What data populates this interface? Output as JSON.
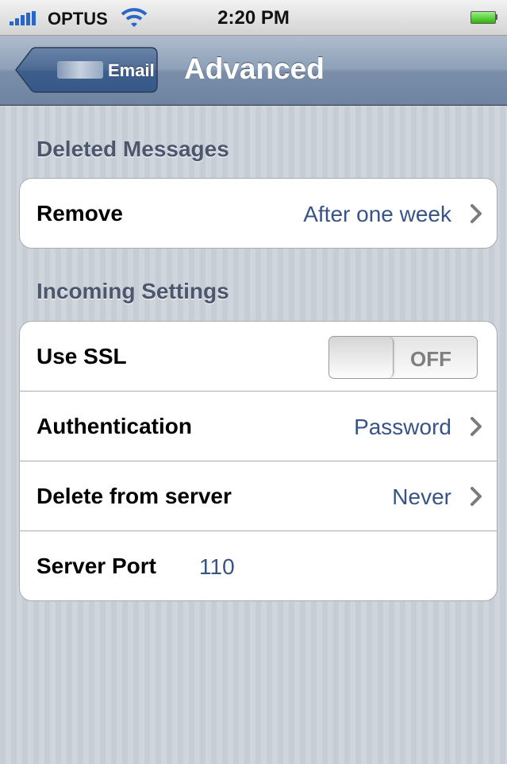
{
  "status_bar": {
    "carrier": "OPTUS",
    "time": "2:20 PM"
  },
  "nav_bar": {
    "back_label": "Email",
    "title": "Advanced"
  },
  "sections": {
    "deleted": {
      "header": "Deleted Messages",
      "remove": {
        "label": "Remove",
        "value": "After one week"
      }
    },
    "incoming": {
      "header": "Incoming Settings",
      "ssl": {
        "label": "Use SSL",
        "toggle_text": "OFF"
      },
      "auth": {
        "label": "Authentication",
        "value": "Password"
      },
      "delete_server": {
        "label": "Delete from server",
        "value": "Never"
      },
      "port": {
        "label": "Server Port",
        "value": "110"
      }
    }
  },
  "colors": {
    "value_blue": "#385487",
    "section_header": "#4c566c",
    "nav_bar": "#6d84a1"
  },
  "icons": {
    "signal": "signal-bars-icon",
    "wifi": "wifi-icon",
    "battery": "battery-icon",
    "chevron": "chevron-right-icon"
  }
}
